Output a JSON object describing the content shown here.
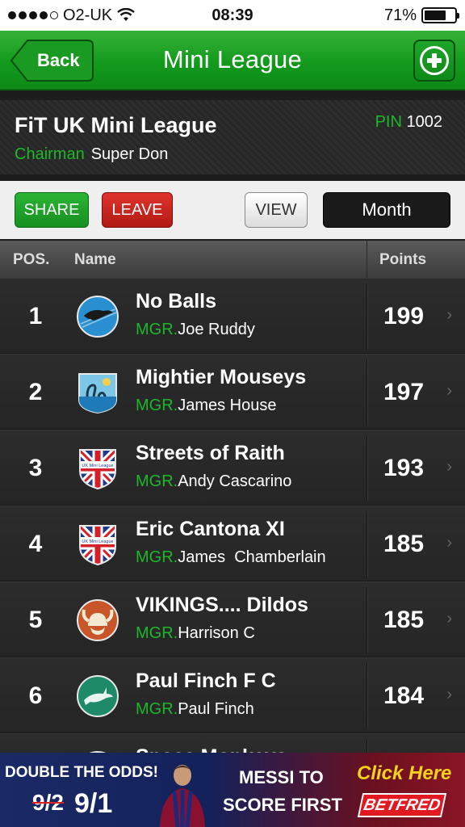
{
  "status_bar": {
    "carrier": "O2-UK",
    "time": "08:39",
    "battery_percent": "71%",
    "battery_level": 0.71,
    "signal_bars": 4
  },
  "header": {
    "back_label": "Back",
    "title": "Mini League",
    "accent_color": "#129a1c"
  },
  "league": {
    "name": "FiT UK Mini League",
    "pin_label": "PIN",
    "pin_value": "1002",
    "chairman_label": "Chairman",
    "chairman_name": "Super Don"
  },
  "controls": {
    "share_label": "SHARE",
    "leave_label": "LEAVE",
    "view_label": "VIEW",
    "period_label": "Month"
  },
  "table": {
    "headers": {
      "pos": "POS.",
      "name": "Name",
      "points": "Points"
    },
    "mgr_prefix": "MGR.",
    "rows": [
      {
        "pos": "1",
        "team": "No Balls",
        "manager": "Joe Ruddy",
        "points": "199",
        "badge": "otter-badge-icon"
      },
      {
        "pos": "2",
        "team": "Mightier Mouseys",
        "manager": "James House",
        "points": "197",
        "badge": "loch-ness-badge-icon"
      },
      {
        "pos": "3",
        "team": "Streets of Raith",
        "manager": "Andy Cascarino",
        "points": "193",
        "badge": "union-jack-shield-icon"
      },
      {
        "pos": "4",
        "team": "Eric Cantona XI",
        "manager": "James  Chamberlain",
        "points": "185",
        "badge": "union-jack-shield-icon"
      },
      {
        "pos": "5",
        "team": "VIKINGS.... Dildos",
        "manager": "Harrison C",
        "points": "185",
        "badge": "viking-helmet-badge-icon"
      },
      {
        "pos": "6",
        "team": "Paul Finch F C",
        "manager": "Paul Finch",
        "points": "184",
        "badge": "shark-badge-icon"
      },
      {
        "pos": "",
        "team": "Space Monkeys",
        "manager": "",
        "points": "",
        "badge": "space-badge-icon"
      }
    ],
    "shield_text": "UK Mini League"
  },
  "ad": {
    "headline": "DOUBLE THE ODDS!",
    "odds_old": "9/2",
    "odds_new": "9/1",
    "line1": "MESSI TO",
    "line2": "SCORE FIRST",
    "cta": "Click Here",
    "brand": "BETFRED"
  }
}
